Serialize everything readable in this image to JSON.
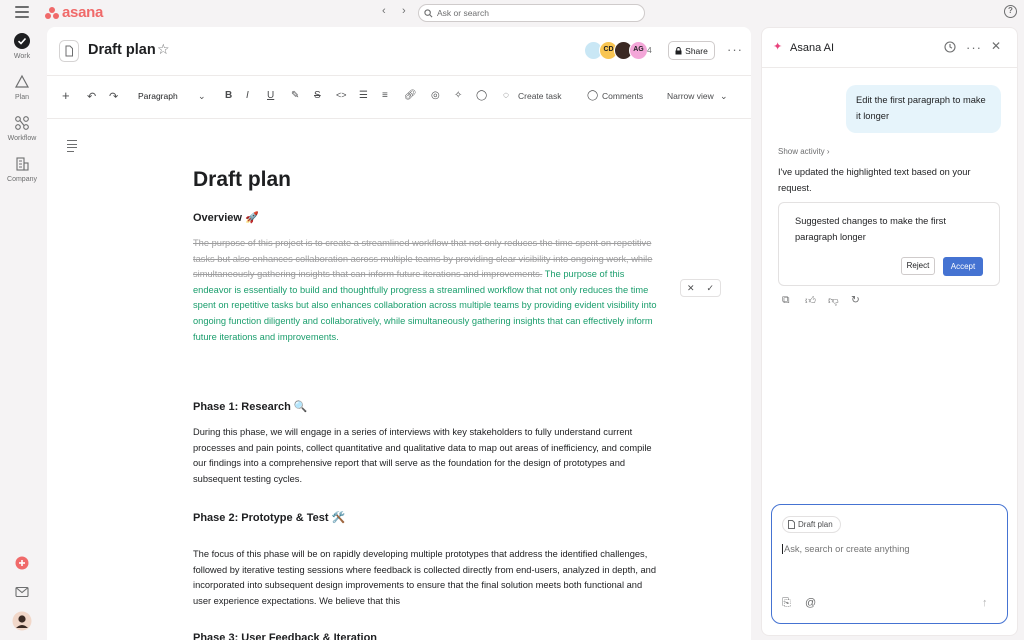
{
  "topbar": {
    "logo_text": "asana",
    "search_placeholder": "Ask or search",
    "help_glyph": "?"
  },
  "rail": {
    "items": [
      {
        "label": "Work",
        "icon": "check-circle-icon"
      },
      {
        "label": "Plan",
        "icon": "triangle-icon"
      },
      {
        "label": "Workflow",
        "icon": "workflow-icon"
      },
      {
        "label": "Company",
        "icon": "building-icon"
      }
    ]
  },
  "doc": {
    "title": "Draft plan",
    "avatar_initials": [
      "",
      "CD",
      "",
      "AG"
    ],
    "avatar_count": "4",
    "share_label": "Share",
    "toolbar": {
      "paragraph_style": "Paragraph",
      "create_task": "Create task",
      "comments": "Comments",
      "narrow_view": "Narrow view"
    },
    "heading": "Draft plan",
    "overview_heading": "Overview 🚀",
    "overview_old": "The purpose of this project is to create a streamlined workflow that not only reduces the time spent on repetitive tasks but also enhances collaboration across multiple teams by providing clear visibility into ongoing work, while simultaneously gathering insights that can inform future iterations and improvements.",
    "overview_new": "The purpose of this endeavor is essentially to build and thoughtfully progress a streamlined workflow that not only reduces the time spent on repetitive tasks but also enhances collaboration across multiple teams by providing evident visibility into ongoing function diligently and collaboratively, while simultaneously gathering insights that can effectively inform future iterations and improvements.",
    "phase1_heading": "Phase 1: Research 🔍",
    "phase1_text": "During this phase, we will engage in a series of interviews with key stakeholders to fully understand current processes and pain points, collect quantitative and qualitative data to map out areas of inefficiency, and compile our findings into a comprehensive report that will serve as the foundation for the design of prototypes and subsequent testing cycles.",
    "phase2_heading": "Phase 2: Prototype & Test 🛠️",
    "phase2_text": "The focus of this phase will be on rapidly developing multiple prototypes that address the identified challenges, followed by iterative testing sessions where feedback is collected directly from end-users, analyzed in depth, and incorporated into subsequent design improvements to ensure that the final solution meets both functional and user experience expectations. We believe that this",
    "phase3_heading": "Phase 3: User Feedback & Iteration"
  },
  "ai": {
    "title": "Asana AI",
    "user_message": "Edit the first paragraph to make it longer",
    "show_activity": "Show activity",
    "reply": "I've updated the highlighted text based on your request.",
    "suggestion_text": "Suggested changes to make the first paragraph longer",
    "reject_label": "Reject",
    "accept_label": "Accept",
    "chip_label": "Draft plan",
    "input_placeholder": "Ask, search or create anything"
  },
  "colors": {
    "brand": "#f06a6a",
    "accent_blue": "#4573d2",
    "suggest_green": "#1b9e6d",
    "bubble_bg": "#e6f4fb"
  }
}
